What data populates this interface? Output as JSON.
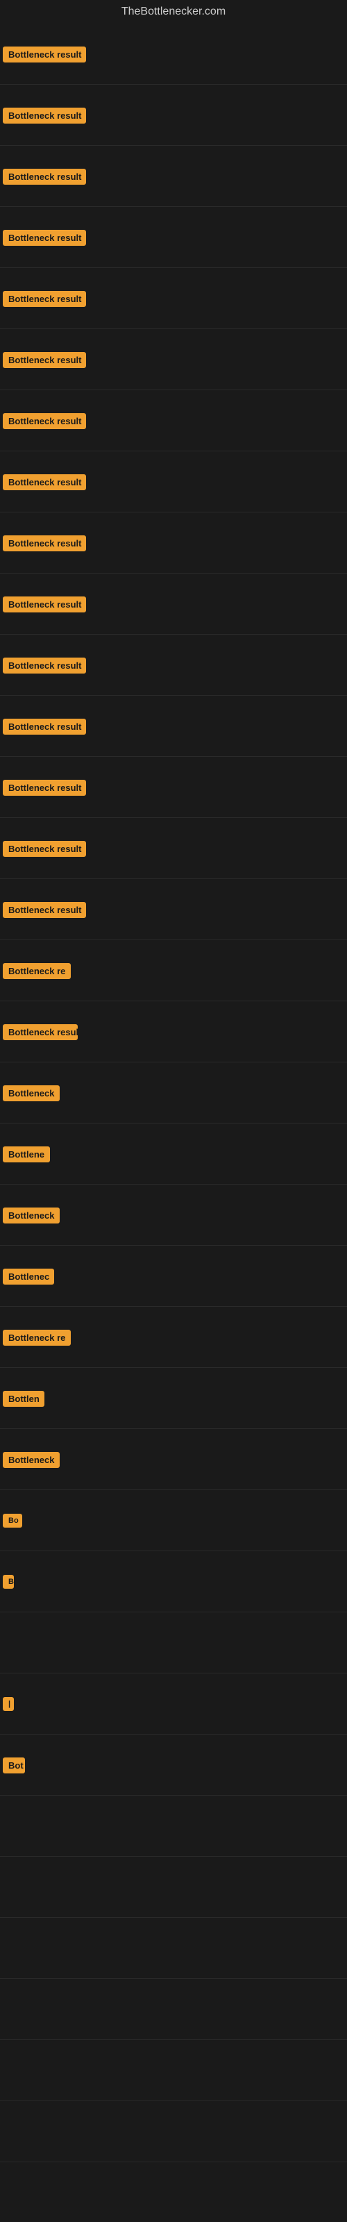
{
  "header": {
    "title": "TheBottlenecker.com"
  },
  "tags": [
    {
      "label": "Bottleneck result",
      "width": 120,
      "visible": "Bottleneck result"
    },
    {
      "label": "Bottleneck result",
      "width": 120,
      "visible": "Bottleneck result"
    },
    {
      "label": "Bottleneck result",
      "width": 120,
      "visible": "Bottleneck result"
    },
    {
      "label": "Bottleneck result",
      "width": 120,
      "visible": "Bottleneck result"
    },
    {
      "label": "Bottleneck result",
      "width": 120,
      "visible": "Bottleneck result"
    },
    {
      "label": "Bottleneck result",
      "width": 120,
      "visible": "Bottleneck result"
    },
    {
      "label": "Bottleneck result",
      "width": 120,
      "visible": "Bottleneck result"
    },
    {
      "label": "Bottleneck result",
      "width": 120,
      "visible": "Bottleneck result"
    },
    {
      "label": "Bottleneck result",
      "width": 120,
      "visible": "Bottleneck result"
    },
    {
      "label": "Bottleneck result",
      "width": 120,
      "visible": "Bottleneck result"
    },
    {
      "label": "Bottleneck result",
      "width": 120,
      "visible": "Bottleneck result"
    },
    {
      "label": "Bottleneck result",
      "width": 120,
      "visible": "Bottleneck result"
    },
    {
      "label": "Bottleneck result",
      "width": 120,
      "visible": "Bottleneck result"
    },
    {
      "label": "Bottleneck result",
      "width": 120,
      "visible": "Bottleneck result"
    },
    {
      "label": "Bottleneck result",
      "width": 120,
      "visible": "Bottleneck result"
    },
    {
      "label": "Bottleneck re",
      "width": 100,
      "visible": "Bottleneck re"
    },
    {
      "label": "Bottleneck resul",
      "width": 108,
      "visible": "Bottleneck resul"
    },
    {
      "label": "Bottleneck",
      "width": 82,
      "visible": "Bottleneck"
    },
    {
      "label": "Bottlene",
      "width": 68,
      "visible": "Bottlene"
    },
    {
      "label": "Bottleneck",
      "width": 82,
      "visible": "Bottleneck"
    },
    {
      "label": "Bottlenec",
      "width": 74,
      "visible": "Bottlenec"
    },
    {
      "label": "Bottleneck re",
      "width": 100,
      "visible": "Bottleneck re"
    },
    {
      "label": "Bottlen",
      "width": 60,
      "visible": "Bottlen"
    },
    {
      "label": "Bottleneck",
      "width": 82,
      "visible": "Bottleneck"
    },
    {
      "label": "Bo",
      "width": 28,
      "visible": "Bo"
    },
    {
      "label": "B",
      "width": 16,
      "visible": "B"
    },
    {
      "label": "",
      "width": 8,
      "visible": ""
    },
    {
      "label": "|",
      "width": 8,
      "visible": "|"
    },
    {
      "label": "Bot",
      "width": 32,
      "visible": "Bot"
    },
    {
      "label": "",
      "width": 0,
      "visible": ""
    },
    {
      "label": "",
      "width": 0,
      "visible": ""
    },
    {
      "label": "",
      "width": 0,
      "visible": ""
    },
    {
      "label": "",
      "width": 0,
      "visible": ""
    },
    {
      "label": "",
      "width": 0,
      "visible": ""
    },
    {
      "label": "",
      "width": 0,
      "visible": ""
    }
  ]
}
